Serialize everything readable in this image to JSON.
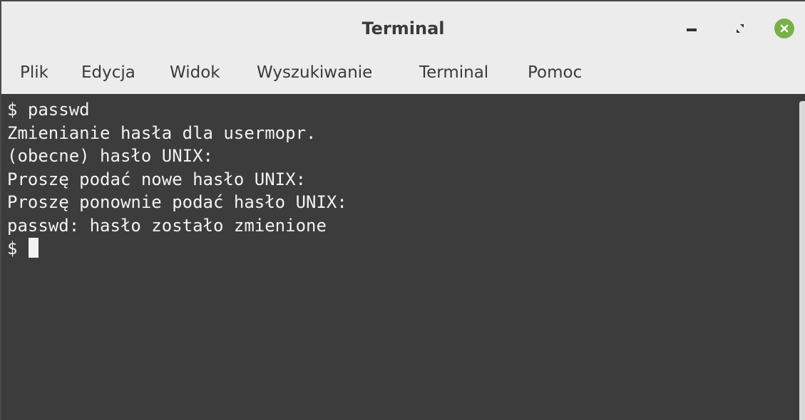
{
  "window": {
    "title": "Terminal"
  },
  "controls": {
    "minimize_icon": "minimize-icon",
    "maximize_icon": "maximize-icon",
    "close_icon": "close-icon"
  },
  "menu": {
    "items": [
      "Plik",
      "Edycja",
      "Widok",
      "Wyszukiwanie",
      "Terminal",
      "Pomoc"
    ]
  },
  "terminal": {
    "lines": [
      "$ passwd",
      "Zmienianie hasła dla usermopr.",
      "(obecne) hasło UNIX:",
      "Proszę podać nowe hasło UNIX:",
      "Proszę ponownie podać hasło UNIX:",
      "passwd: hasło zostało zmienione"
    ],
    "prompt": "$ "
  },
  "colors": {
    "terminal_bg": "#3c3c3c",
    "terminal_fg": "#f2f2f2",
    "titlebar_bg": "#ececec",
    "close_button": "#78b04a"
  }
}
